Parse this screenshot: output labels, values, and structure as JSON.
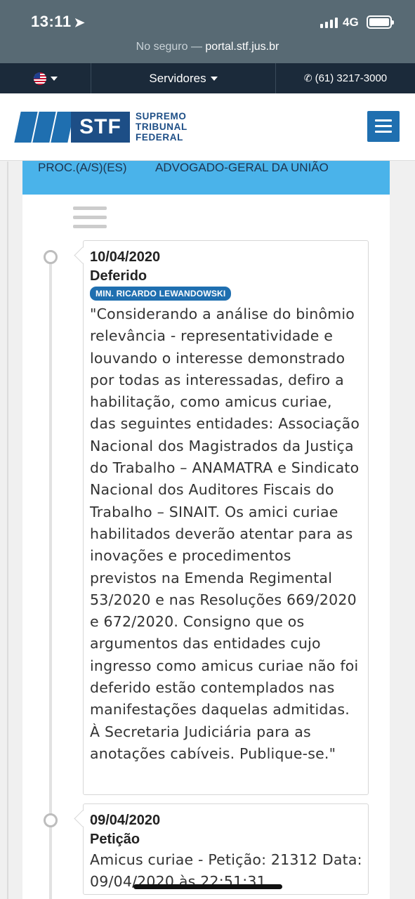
{
  "status": {
    "time": "13:11",
    "network": "4G",
    "url_prefix": "No seguro —",
    "url_domain": "portal.stf.jus.br"
  },
  "topbar": {
    "servers_label": "Servidores",
    "phone": "(61) 3217-3000"
  },
  "header": {
    "logo_abbr": "STF",
    "logo_line1": "SUPREMO",
    "logo_line2": "TRIBUNAL",
    "logo_line3": "FEDERAL"
  },
  "party": {
    "label": "PROC.(A/S)(ES)",
    "value": "ADVOGADO-GERAL DA UNIÃO"
  },
  "events": [
    {
      "date": "10/04/2020",
      "type": "Deferido",
      "minister": "MIN. RICARDO LEWANDOWSKI",
      "text": "\"Considerando a análise do binômio relevância - representatividade e louvando o interesse demonstrado por todas as interessadas, defiro a habilitação, como amicus curiae, das seguintes entidades: Associação Nacional dos Magistrados da Justiça do Trabalho – ANAMATRA e Sindicato Nacional dos Auditores Fiscais do Trabalho – SINAIT. Os amici curiae habilitados deverão atentar para as inovações e procedimentos previstos na Emenda Regimental 53/2020 e nas Resoluções 669/2020 e 672/2020. Consigno que os argumentos das entidades cujo ingresso como amicus curiae não foi deferido estão contemplados nas manifestações daquelas admitidas. À Secretaria Judiciária para as anotações cabíveis. Publique-se.\""
    },
    {
      "date": "09/04/2020",
      "type": "Petição",
      "text": "Amicus curiae - Petição: 21312 Data: 09/04/2020 às 22:51:31"
    }
  ],
  "colors": {
    "status_bg": "#586a74",
    "topbar_bg": "#1b2a3a",
    "brand_blue": "#1f6fb0",
    "band_blue": "#4ab3ea"
  }
}
